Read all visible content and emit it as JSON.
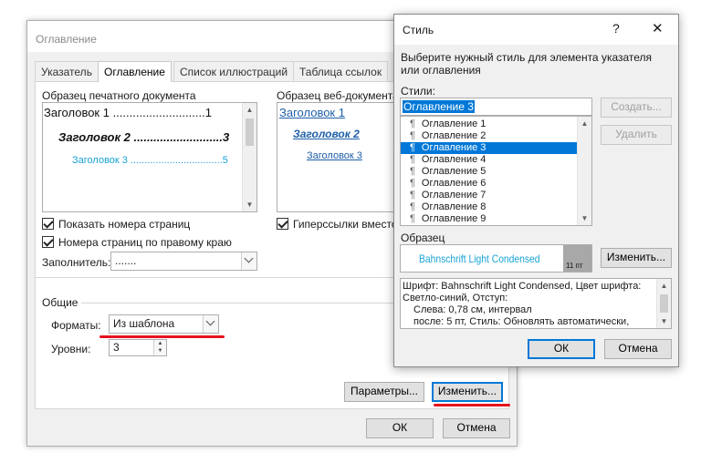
{
  "toc_dialog": {
    "title": "Оглавление",
    "tabs": [
      "Указатель",
      "Оглавление",
      "Список иллюстраций",
      "Таблица ссылок"
    ],
    "print_preview": {
      "label": "Образец печатного документа",
      "lines": [
        "Заголовок 1 ............................1",
        "Заголовок 2 ...........................3",
        "Заголовок 3 .................................5"
      ]
    },
    "web_preview": {
      "label": "Образец веб-документа",
      "lines": [
        "Заголовок 1",
        "Заголовок 2",
        "Заголовок 3"
      ]
    },
    "show_page_numbers": {
      "label": "Показать номера страниц",
      "checked": true
    },
    "right_align": {
      "label": "Номера страниц по правому краю",
      "checked": true
    },
    "hyperlinks": {
      "label": "Гиперссылки вместо",
      "checked": true
    },
    "tab_leader": {
      "label": "Заполнитель:",
      "value": "......."
    },
    "general": {
      "label": "Общие",
      "formats_label": "Форматы:",
      "formats_value": "Из шаблона",
      "levels_label": "Уровни:",
      "levels_value": "3"
    },
    "options_button": "Параметры...",
    "modify_button": "Изменить...",
    "ok_button": "ОК",
    "cancel_button": "Отмена"
  },
  "style_dialog": {
    "title": "Стиль",
    "help": "?",
    "close": "✕",
    "instruction": "Выберите нужный стиль для элемента указателя или оглавления",
    "styles_label": "Стили:",
    "style_name_value": "Оглавление 3",
    "styles": [
      "Оглавление 1",
      "Оглавление 2",
      "Оглавление 3",
      "Оглавление 4",
      "Оглавление 5",
      "Оглавление 6",
      "Оглавление 7",
      "Оглавление 8",
      "Оглавление 9"
    ],
    "selected_index": 2,
    "create_button": "Создать...",
    "delete_button": "Удалить",
    "preview_label": "Образец",
    "preview_font": "Bahnschrift Light Condensed",
    "preview_size": "11 пт",
    "modify_button": "Изменить...",
    "description": [
      "Шрифт: Bahnschrift Light Condensed, Цвет шрифта:",
      "Светло-синий, Отступ:",
      "Слева:  0,78 см, интервал",
      "после: 5 пт, Стиль: Обновлять автоматически,"
    ],
    "ok_button": "ОК",
    "cancel_button": "Отмена"
  },
  "colors": {
    "accent": "#0078d7",
    "highlight_red": "#e4141e",
    "light_blue_preview": "#1aa3d6",
    "link_blue": "#1f5fa8"
  }
}
